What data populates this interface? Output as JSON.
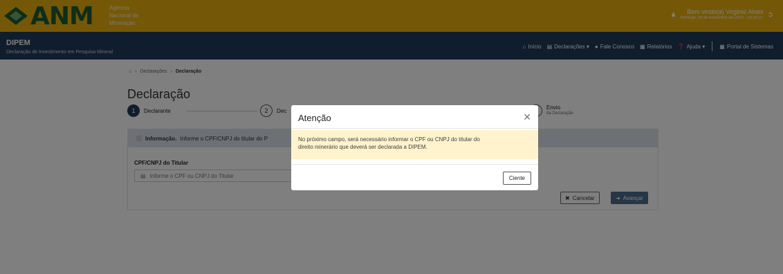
{
  "header": {
    "logo_text": "ANM",
    "agency_line1": "Agência",
    "agency_line2": "Nacional de",
    "agency_line3": "Mineração",
    "user_name": "Bem vindo(a) Virgínio Alves",
    "user_date": "domingo 19 de novembro de 2023 - 20:53:27",
    "brand_yellow": "#e8b00f",
    "brand_navy": "#1e3a59"
  },
  "navbar": {
    "title": "DIPEM",
    "subtitle": "Declaração de Investimento em Pesquisa Mineral",
    "items": [
      {
        "icon": "home-icon",
        "label": "Início"
      },
      {
        "icon": "file-icon",
        "label": "Declarações ▾"
      },
      {
        "icon": "chat-icon",
        "label": "Fale Conosco"
      },
      {
        "icon": "chart-icon",
        "label": "Relatórios"
      },
      {
        "icon": "help-icon",
        "label": "Ajuda ▾"
      }
    ],
    "portal_label": "Portal de Sistemas"
  },
  "breadcrumb": {
    "level1": "Declarações",
    "current": "Declaração"
  },
  "page": {
    "title": "Declaração"
  },
  "stepper": {
    "step1_number": "1",
    "step1_label": "Declarante",
    "step2_number": "2",
    "step2_label": "Dec",
    "step4_label": "Envio",
    "step4_sub": "da Declaração"
  },
  "form": {
    "info_bold": "Informação.",
    "info_text": "Informe o CPF/CNPJ do titular do P",
    "field_label": "CPF/CNPJ do Titular",
    "field_placeholder": "Informe o CPF ou CNPJ do Titular",
    "cancel_label": "Cancelar",
    "next_label": "Avançar"
  },
  "modal": {
    "title": "Atenção",
    "message_line1": "No próximo campo, será necessário informar o CPF ou CNPJ do titular do",
    "message_line2": "direito minerário que deverá ser declarada a DIPEM.",
    "ok_label": "Ciente"
  }
}
